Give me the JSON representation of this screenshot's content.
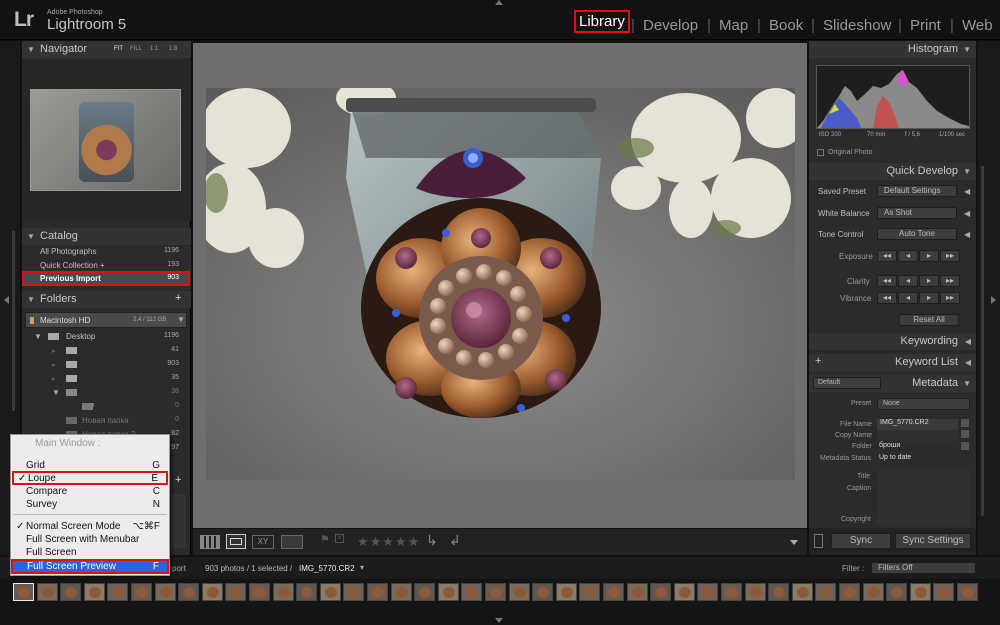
{
  "app": {
    "logo": "Lr",
    "vendor": "Adobe Photoshop",
    "name": "Lightroom 5"
  },
  "modules": [
    "Library",
    "Develop",
    "Map",
    "Book",
    "Slideshow",
    "Print",
    "Web"
  ],
  "active_module": "Library",
  "navigator": {
    "title": "Navigator",
    "zoom_options": [
      "FIT",
      "FILL",
      "1:1",
      "1:8"
    ]
  },
  "catalog": {
    "title": "Catalog",
    "items": [
      {
        "label": "All Photographs",
        "count": "1196"
      },
      {
        "label": "Quick Collection +",
        "count": "193"
      },
      {
        "label": "Previous Import",
        "count": "903"
      }
    ]
  },
  "folders": {
    "title": "Folders",
    "volume": "Macintosh HD",
    "volume_info": "2,4 / 112 GB",
    "items": [
      {
        "label": "Desktop",
        "count": "1196"
      },
      {
        "label": "",
        "count": "41"
      },
      {
        "label": "",
        "count": "903"
      },
      {
        "label": "",
        "count": "35"
      },
      {
        "label": "",
        "count": "38"
      },
      {
        "label": "?",
        "count": "0"
      },
      {
        "label": "Новая папка",
        "count": "0"
      },
      {
        "label": "Новая папка 2",
        "count": "82"
      },
      {
        "label": "",
        "count": "97"
      }
    ]
  },
  "context_menu": {
    "header": "Main Window :",
    "items": [
      {
        "label": "Grid",
        "shortcut": "G",
        "checked": false
      },
      {
        "label": "Loupe",
        "shortcut": "E",
        "checked": true
      },
      {
        "label": "Compare",
        "shortcut": "C",
        "checked": false
      },
      {
        "label": "Survey",
        "shortcut": "N",
        "checked": false
      },
      {
        "label": "Normal Screen Mode",
        "shortcut": "⌥⌘F",
        "checked": true
      },
      {
        "label": "Full Screen with Menubar",
        "shortcut": "",
        "checked": false
      },
      {
        "label": "Full Screen",
        "shortcut": "",
        "checked": false
      },
      {
        "label": "Full Screen Preview",
        "shortcut": "F",
        "checked": false
      }
    ]
  },
  "histogram": {
    "title": "Histogram",
    "iso": "ISO 200",
    "focal": "70 mm",
    "aperture": "f / 5,6",
    "shutter": "1/100 sec",
    "original_photo": "Original Photo"
  },
  "quick_develop": {
    "title": "Quick Develop",
    "saved_preset_label": "Saved Preset",
    "saved_preset_value": "Default Settings",
    "white_balance_label": "White Balance",
    "white_balance_value": "As Shot",
    "tone_control_label": "Tone Control",
    "auto_tone": "Auto Tone",
    "exposure": "Exposure",
    "clarity": "Clarity",
    "vibrance": "Vibrance",
    "reset_all": "Reset All"
  },
  "keywording": {
    "title": "Keywording"
  },
  "keyword_list": {
    "title": "Keyword List"
  },
  "metadata": {
    "title": "Metadata",
    "preset_dropdown": "Default",
    "preset_label": "Preset",
    "preset_value": "None",
    "file_name_label": "File Name",
    "file_name": "IMG_5770.CR2",
    "copy_name_label": "Copy Name",
    "copy_name": "",
    "folder_label": "Folder",
    "folder": "броши",
    "status_label": "Metadata Status",
    "status": "Up to date",
    "title_label": "Title",
    "caption_label": "Caption",
    "copyright_label": "Copyright"
  },
  "sync": {
    "sync": "Sync",
    "sync_settings": "Sync Settings"
  },
  "filmstrip": {
    "source_text": "port",
    "info": "903 photos / 1 selected /",
    "file": "IMG_5770.CR2",
    "filter_label": "Filter :",
    "filter_value": "Filters Off"
  },
  "colors": {
    "accent_red": "#e01010",
    "panel": "#2b2b2b",
    "background": "#111111"
  }
}
